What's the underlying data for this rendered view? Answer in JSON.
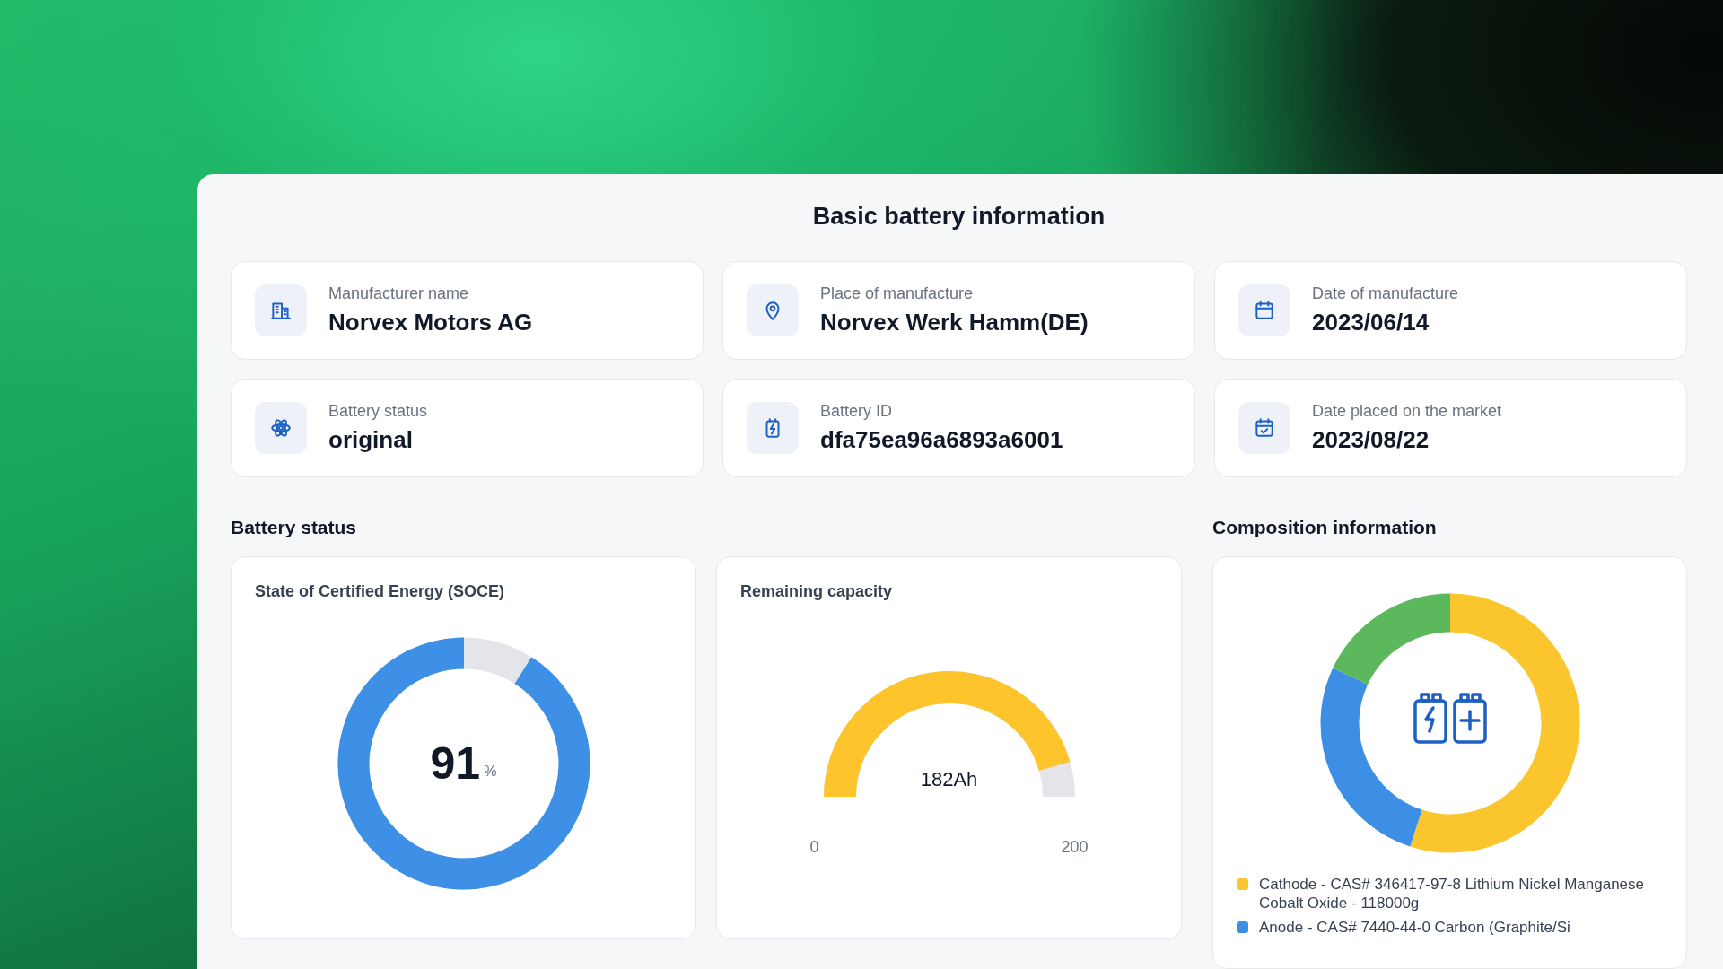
{
  "page": {
    "title": "Basic battery information"
  },
  "info_cards": [
    {
      "label": "Manufacturer name",
      "value": "Norvex Motors AG"
    },
    {
      "label": "Place of manufacture",
      "value": "Norvex Werk Hamm(DE)"
    },
    {
      "label": "Date of manufacture",
      "value": "2023/06/14"
    },
    {
      "label": "Battery status",
      "value": "original"
    },
    {
      "label": "Battery ID",
      "value": "dfa75ea96a6893a6001"
    },
    {
      "label": "Date placed on the market",
      "value": "2023/08/22"
    }
  ],
  "battery_status": {
    "heading": "Battery status",
    "soce": {
      "title": "State of Certified Energy (SOCE)",
      "value": "91",
      "unit": "%"
    },
    "remaining_capacity": {
      "title": "Remaining capacity",
      "reading": "182Ah",
      "min": "0",
      "max": "200"
    }
  },
  "composition": {
    "heading": "Composition information",
    "legend": [
      {
        "label": "Cathode - CAS# 346417-97-8 Lithium Nickel Manganese Cobalt Oxide - 118000g",
        "color": "#fbc52d"
      },
      {
        "label": "Anode - CAS# 7440-44-0 Carbon (Graphite/Si",
        "color": "#3d8fe5"
      }
    ]
  }
}
